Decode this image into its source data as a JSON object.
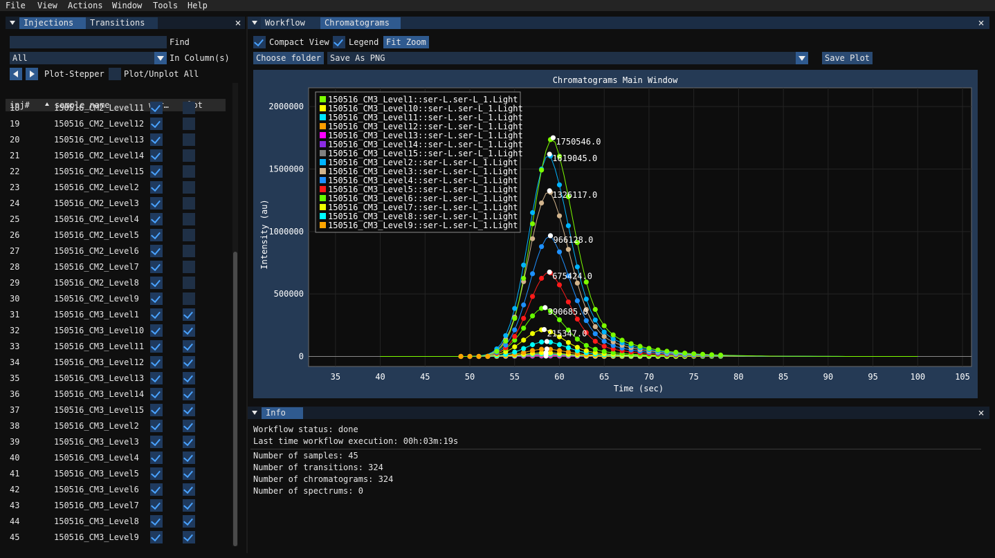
{
  "menu": [
    "File",
    "View",
    "Actions",
    "Window",
    "Tools",
    "Help"
  ],
  "left": {
    "tabs": [
      "Injections",
      "Transitions"
    ],
    "find_label": "Find",
    "find_value": "",
    "column_select": "All",
    "in_columns_label": "In Column(s)",
    "plot_stepper_label": "Plot-Stepper",
    "plot_unplot_label": "Plot/Unplot All",
    "headers": [
      "inj#",
      "sample_name",
      "wor…",
      "plot"
    ],
    "rows": [
      {
        "inj": "18",
        "name": "150516_CM2_Level11",
        "wf": true,
        "plot": false
      },
      {
        "inj": "19",
        "name": "150516_CM2_Level12",
        "wf": true,
        "plot": false
      },
      {
        "inj": "20",
        "name": "150516_CM2_Level13",
        "wf": true,
        "plot": false
      },
      {
        "inj": "21",
        "name": "150516_CM2_Level14",
        "wf": true,
        "plot": false
      },
      {
        "inj": "22",
        "name": "150516_CM2_Level15",
        "wf": true,
        "plot": false
      },
      {
        "inj": "23",
        "name": "150516_CM2_Level2",
        "wf": true,
        "plot": false
      },
      {
        "inj": "24",
        "name": "150516_CM2_Level3",
        "wf": true,
        "plot": false
      },
      {
        "inj": "25",
        "name": "150516_CM2_Level4",
        "wf": true,
        "plot": false
      },
      {
        "inj": "26",
        "name": "150516_CM2_Level5",
        "wf": true,
        "plot": false
      },
      {
        "inj": "27",
        "name": "150516_CM2_Level6",
        "wf": true,
        "plot": false
      },
      {
        "inj": "28",
        "name": "150516_CM2_Level7",
        "wf": true,
        "plot": false
      },
      {
        "inj": "29",
        "name": "150516_CM2_Level8",
        "wf": true,
        "plot": false
      },
      {
        "inj": "30",
        "name": "150516_CM2_Level9",
        "wf": true,
        "plot": false
      },
      {
        "inj": "31",
        "name": "150516_CM3_Level1",
        "wf": true,
        "plot": true
      },
      {
        "inj": "32",
        "name": "150516_CM3_Level10",
        "wf": true,
        "plot": true
      },
      {
        "inj": "33",
        "name": "150516_CM3_Level11",
        "wf": true,
        "plot": true
      },
      {
        "inj": "34",
        "name": "150516_CM3_Level12",
        "wf": true,
        "plot": true
      },
      {
        "inj": "35",
        "name": "150516_CM3_Level13",
        "wf": true,
        "plot": true
      },
      {
        "inj": "36",
        "name": "150516_CM3_Level14",
        "wf": true,
        "plot": true
      },
      {
        "inj": "37",
        "name": "150516_CM3_Level15",
        "wf": true,
        "plot": true
      },
      {
        "inj": "38",
        "name": "150516_CM3_Level2",
        "wf": true,
        "plot": true
      },
      {
        "inj": "39",
        "name": "150516_CM3_Level3",
        "wf": true,
        "plot": true
      },
      {
        "inj": "40",
        "name": "150516_CM3_Level4",
        "wf": true,
        "plot": true
      },
      {
        "inj": "41",
        "name": "150516_CM3_Level5",
        "wf": true,
        "plot": true
      },
      {
        "inj": "42",
        "name": "150516_CM3_Level6",
        "wf": true,
        "plot": true
      },
      {
        "inj": "43",
        "name": "150516_CM3_Level7",
        "wf": true,
        "plot": true
      },
      {
        "inj": "44",
        "name": "150516_CM3_Level8",
        "wf": true,
        "plot": true
      },
      {
        "inj": "45",
        "name": "150516_CM3_Level9",
        "wf": true,
        "plot": true
      }
    ]
  },
  "main": {
    "tabs": [
      "Workflow",
      "Chromatograms"
    ],
    "compact_view_label": "Compact View",
    "legend_label": "Legend",
    "fit_zoom_label": "Fit Zoom",
    "choose_folder_label": "Choose folder",
    "save_format": "Save As PNG",
    "save_plot_label": "Save Plot"
  },
  "chart_data": {
    "type": "scatter",
    "title": "Chromatograms Main Window",
    "xlabel": "Time (sec)",
    "ylabel": "Intensity (au)",
    "xlim": [
      32,
      106
    ],
    "ylim": [
      -80000,
      2150000
    ],
    "xticks": [
      35,
      40,
      45,
      50,
      55,
      60,
      65,
      70,
      75,
      80,
      85,
      90,
      95,
      100,
      105
    ],
    "yticks": [
      0,
      500000,
      1000000,
      1500000,
      2000000
    ],
    "ytick_labels": [
      "0",
      "500000",
      "1000000",
      "1500000",
      "2000000"
    ],
    "legend_position": "top-left",
    "series": [
      {
        "name": "150516_CM3_Level1::ser-L.ser-L_1.Light",
        "color": "#7cfc00",
        "peak": 1750546,
        "apex": 59.3,
        "sigma": 2.3
      },
      {
        "name": "150516_CM3_Level10::ser-L.ser-L_1.Light",
        "color": "#ffff00",
        "peak": 30000,
        "apex": 58.5,
        "sigma": 2.3
      },
      {
        "name": "150516_CM3_Level11::ser-L.ser-L_1.Light",
        "color": "#00e5ff",
        "peak": 20000,
        "apex": 58.5,
        "sigma": 2.3
      },
      {
        "name": "150516_CM3_Level12::ser-L.ser-L_1.Light",
        "color": "#ff9f00",
        "peak": 15000,
        "apex": 58.5,
        "sigma": 2.3
      },
      {
        "name": "150516_CM3_Level13::ser-L.ser-L_1.Light",
        "color": "#ff00ff",
        "peak": 10000,
        "apex": 58.5,
        "sigma": 2.3
      },
      {
        "name": "150516_CM3_Level14::ser-L.ser-L_1.Light",
        "color": "#8a2be2",
        "peak": 6000,
        "apex": 58.5,
        "sigma": 2.3
      },
      {
        "name": "150516_CM3_Level15::ser-L.ser-L_1.Light",
        "color": "#808080",
        "peak": 3000,
        "apex": 58.5,
        "sigma": 2.3
      },
      {
        "name": "150516_CM3_Level2::ser-L.ser-L_1.Light",
        "color": "#00b4ff",
        "peak": 1619045,
        "apex": 58.9,
        "sigma": 2.3
      },
      {
        "name": "150516_CM3_Level3::ser-L.ser-L_1.Light",
        "color": "#d2b48c",
        "peak": 1326117,
        "apex": 58.9,
        "sigma": 2.3
      },
      {
        "name": "150516_CM3_Level4::ser-L.ser-L_1.Light",
        "color": "#1e90ff",
        "peak": 966128,
        "apex": 59.0,
        "sigma": 2.3
      },
      {
        "name": "150516_CM3_Level5::ser-L.ser-L_1.Light",
        "color": "#ff1a1a",
        "peak": 675424,
        "apex": 58.9,
        "sigma": 2.3
      },
      {
        "name": "150516_CM3_Level6::ser-L.ser-L_1.Light",
        "color": "#66ff00",
        "peak": 390685,
        "apex": 58.4,
        "sigma": 2.3
      },
      {
        "name": "150516_CM3_Level7::ser-L.ser-L_1.Light",
        "color": "#eeff00",
        "peak": 215347,
        "apex": 58.3,
        "sigma": 2.3
      },
      {
        "name": "150516_CM3_Level8::ser-L.ser-L_1.Light",
        "color": "#00ffff",
        "peak": 120000,
        "apex": 58.6,
        "sigma": 2.3
      },
      {
        "name": "150516_CM3_Level9::ser-L.ser-L_1.Light",
        "color": "#ffa500",
        "peak": 60000,
        "apex": 58.6,
        "sigma": 2.3
      }
    ],
    "peak_labels": [
      "1750546.0",
      "1619045.0",
      "1326117.0",
      "966128.0",
      "675424.0",
      "390685.0",
      "215347.0"
    ]
  },
  "info": {
    "tab": "Info",
    "status": "Workflow status: done",
    "last_exec": "Last time workflow execution: 00h:03m:19s",
    "samples": "Number of samples: 45",
    "transitions": "Number of transitions: 324",
    "chromatograms": "Number of chromatograms: 324",
    "spectrums": "Number of spectrums: 0"
  }
}
